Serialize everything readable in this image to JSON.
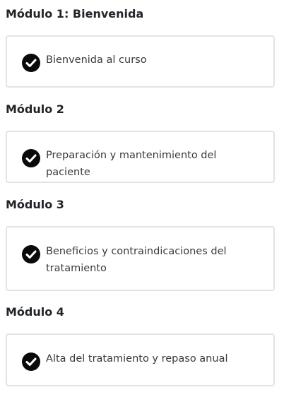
{
  "modules": [
    {
      "title": "Módulo 1: Bienvenida",
      "lessons": [
        {
          "label": "Bienvenida al curso",
          "status": "completed",
          "icon": "check-circle-icon"
        }
      ]
    },
    {
      "title": "Módulo 2",
      "lessons": [
        {
          "label": "Preparación y mantenimiento del paciente",
          "status": "completed",
          "icon": "check-circle-icon"
        }
      ]
    },
    {
      "title": "Módulo 3",
      "lessons": [
        {
          "label": "Beneficios y contraindicaciones del tratamiento",
          "status": "completed",
          "icon": "check-circle-icon"
        }
      ]
    },
    {
      "title": "Módulo 4",
      "lessons": [
        {
          "label": "Alta del tratamiento y repaso anual",
          "status": "completed",
          "icon": "check-circle-icon"
        }
      ]
    }
  ],
  "colors": {
    "text": "#212529",
    "lesson_text": "#3a3a3a",
    "card_border": "#e3e3e6",
    "icon_fill": "#0a0a0a",
    "icon_check": "#ffffff"
  }
}
